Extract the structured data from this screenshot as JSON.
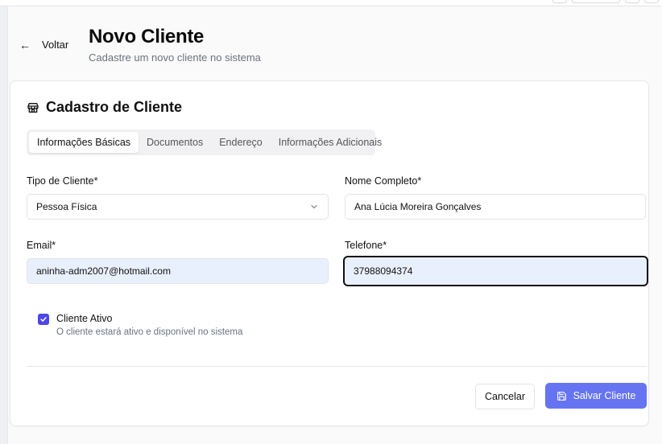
{
  "header": {
    "back_label": "Voltar",
    "title": "Novo Cliente",
    "subtitle": "Cadastre um novo cliente no sistema"
  },
  "card": {
    "title": "Cadastro de Cliente",
    "icon": "store-icon"
  },
  "tabs": [
    {
      "label": "Informações Básicas",
      "active": true
    },
    {
      "label": "Documentos",
      "active": false
    },
    {
      "label": "Endereço",
      "active": false
    },
    {
      "label": "Informações Adicionais",
      "active": false
    }
  ],
  "form": {
    "tipo_cliente": {
      "label": "Tipo de Cliente*",
      "value": "Pessoa Física"
    },
    "nome_completo": {
      "label": "Nome Completo*",
      "value": "Ana Lúcia Moreira Gonçalves"
    },
    "email": {
      "label": "Email*",
      "value": "aninha-adm2007@hotmail.com"
    },
    "telefone": {
      "label": "Telefone*",
      "value": "37988094374"
    },
    "cliente_ativo": {
      "label": "Cliente Ativo",
      "help": "O cliente estará ativo e disponível no sistema",
      "checked": true
    }
  },
  "actions": {
    "cancel_label": "Cancelar",
    "save_label": "Salvar Cliente"
  },
  "colors": {
    "accent": "#6674f2",
    "checkbox": "#4f46e5",
    "autofill_bg": "#e9f0fd"
  }
}
